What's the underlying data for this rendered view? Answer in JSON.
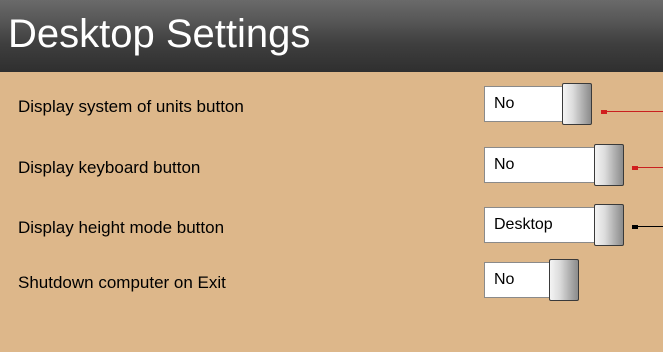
{
  "header": {
    "title": "Desktop Settings"
  },
  "settings": [
    {
      "label": "Display system of units button",
      "value": "No",
      "connector_color": "#c92020"
    },
    {
      "label": "Display keyboard button",
      "value": "No",
      "connector_color": "#c92020"
    },
    {
      "label": "Display height mode button",
      "value": "Desktop",
      "connector_color": "#000000"
    },
    {
      "label": "Shutdown computer on Exit",
      "value": "No",
      "connector_color": null
    }
  ],
  "colors": {
    "background": "#DDB78A",
    "header_dark": "#2f2f2f",
    "accent_red": "#c92020"
  }
}
